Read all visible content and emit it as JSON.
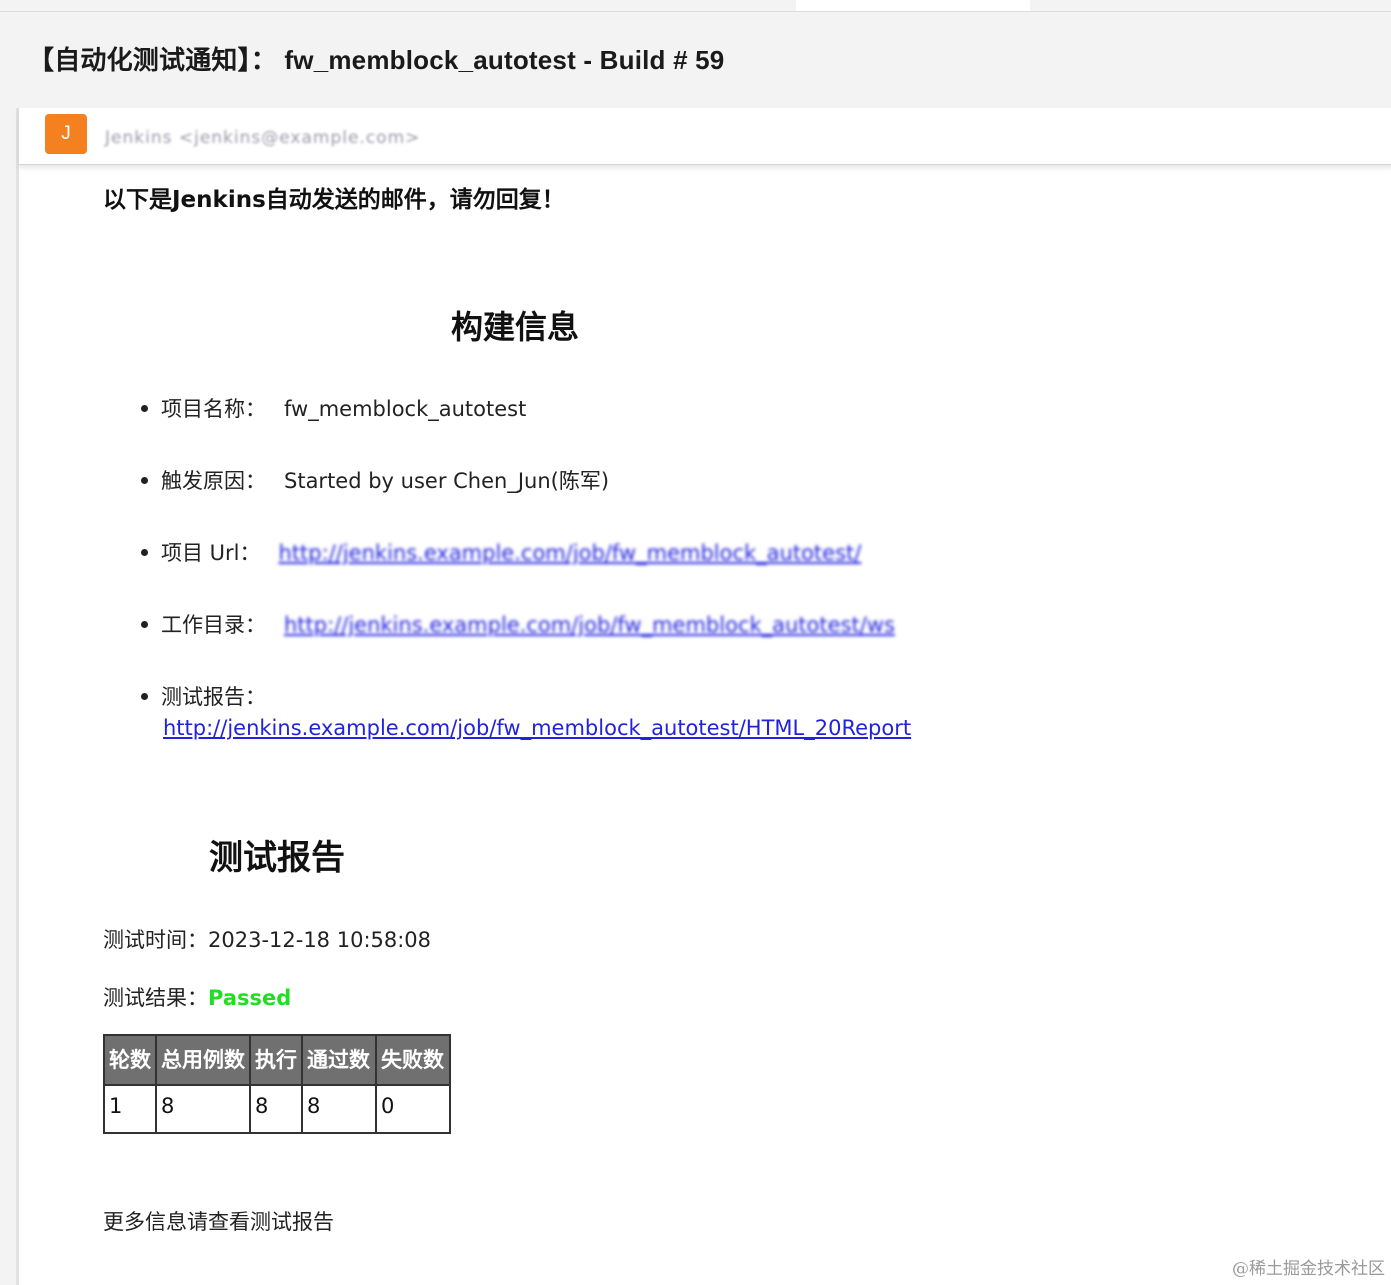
{
  "subject": "【自动化测试通知】： fw_memblock_autotest - Build # 59",
  "sender": {
    "avatar_letter": "J",
    "from": "Jenkins <jenkins@example.com>"
  },
  "body": {
    "intro": "以下是Jenkins自动发送的邮件，请勿回复！",
    "build_info_title": "构建信息",
    "items": [
      {
        "label": "项目名称：",
        "value": "fw_memblock_autotest"
      },
      {
        "label": "触发原因：",
        "value": "Started by user Chen_Jun(陈军)"
      },
      {
        "label": "项目 Url：",
        "value": "http://jenkins.example.com/job/fw_memblock_autotest/"
      },
      {
        "label": "工作目录：",
        "value": "http://jenkins.example.com/job/fw_memblock_autotest/ws"
      },
      {
        "label": "测试报告：",
        "value": "http://jenkins.example.com/job/fw_memblock_autotest/HTML_20Report"
      }
    ],
    "report_title": "测试报告",
    "test_time_label": "测试时间：",
    "test_time": "2023-12-18 10:58:08",
    "test_result_label": "测试结果：",
    "test_result": "Passed",
    "table": {
      "headers": [
        "轮数",
        "总用例数",
        "执行",
        "通过数",
        "失败数"
      ],
      "rows": [
        [
          "1",
          "8",
          "8",
          "8",
          "0"
        ]
      ]
    },
    "more": "更多信息请查看测试报告"
  },
  "watermark": "@稀土掘金技术社区",
  "colors": {
    "avatar": "#f4801f",
    "passed": "#22dd22",
    "failed": "#ee1111",
    "link": "#2222dd",
    "table_header": "#707070"
  }
}
